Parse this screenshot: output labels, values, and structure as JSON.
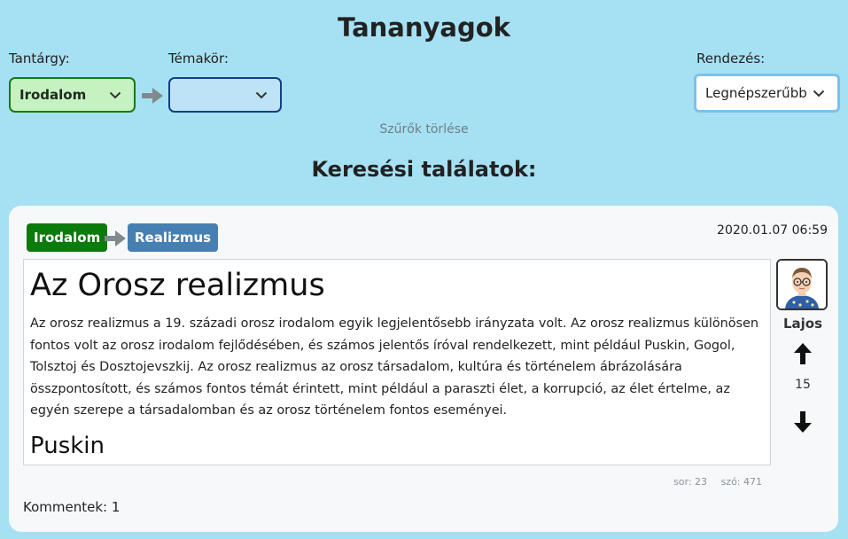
{
  "page": {
    "title": "Tananyagok"
  },
  "filters": {
    "subject_label": "Tantárgy:",
    "subject_value": "Irodalom",
    "topic_label": "Témakör:",
    "topic_value": "",
    "sort_label": "Rendezés:",
    "sort_value": "Legnépszerűbb",
    "clear_label": "Szűrők törlése",
    "colors": {
      "subject_border": "#137d13",
      "subject_bg": "#c6f2c1",
      "topic_border": "#123f86",
      "topic_bg": "#bee3f6"
    }
  },
  "results": {
    "title": "Keresési találatok:",
    "items": [
      {
        "subject": "Irodalom",
        "topic": "Realizmus",
        "date": "2020.01.07 06:59",
        "heading": "Az Orosz realizmus",
        "body": "Az orosz realizmus a 19. századi orosz irodalom egyik legjelentősebb irányzata volt. Az orosz realizmus különösen fontos volt az orosz irodalom fejlődésében, és számos jelentős íróval rendelkezett, mint például Puskin, Gogol, Tolsztoj és Dosztojevszkij. Az orosz realizmus az orosz társadalom, kultúra és történelem ábrázolására összpontosított, és számos fontos témát érintett, mint például a paraszti élet, a korrupció, az élet értelme, az egyén szerepe a társadalomban és az orosz történelem fontos eseményei.",
        "subheading": "Puskin",
        "author": "Lajos",
        "votes": "15",
        "lines": "sor: 23",
        "words": "szó: 471",
        "comments": "Kommentek: 1",
        "icons": [
          "arrow-right-icon",
          "avatar-icon",
          "arrow-up-icon",
          "arrow-down-icon"
        ],
        "colors": {
          "subject_badge": "#0b7b0b",
          "topic_badge": "#4680b2"
        }
      }
    ]
  }
}
